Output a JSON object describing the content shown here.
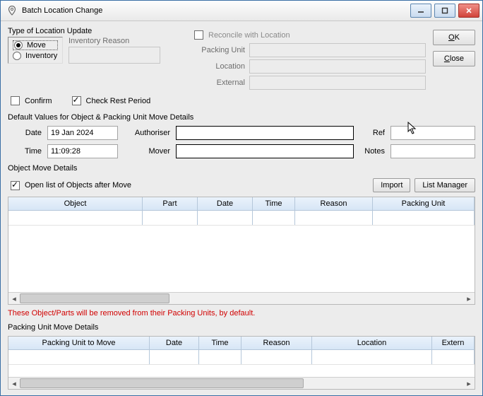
{
  "window": {
    "title": "Batch Location Change"
  },
  "buttons": {
    "ok": "OK",
    "close": "Close",
    "import": "Import",
    "list_manager": "List Manager"
  },
  "type_block": {
    "title": "Type of Location Update",
    "move": "Move",
    "inventory": "Inventory",
    "inv_reason_label": "Inventory Reason"
  },
  "reconcile": {
    "title": "Reconcile with Location",
    "packing_unit": "Packing Unit",
    "location": "Location",
    "external": "External"
  },
  "checks": {
    "confirm": "Confirm",
    "check_rest": "Check Rest Period"
  },
  "defaults": {
    "title": "Default Values for Object & Packing Unit Move Details",
    "date_label": "Date",
    "date_value": "19 Jan 2024",
    "time_label": "Time",
    "time_value": "11:09:28",
    "authoriser_label": "Authoriser",
    "authoriser_value": "",
    "mover_label": "Mover",
    "mover_value": "",
    "ref_label": "Ref",
    "ref_value": "",
    "notes_label": "Notes",
    "notes_value": ""
  },
  "object_section": {
    "title": "Object Move Details",
    "open_after": "Open list of Objects after Move",
    "columns": [
      "Object",
      "Part",
      "Date",
      "Time",
      "Reason",
      "Packing Unit"
    ]
  },
  "warning_text": "These Object/Parts will be removed from their Packing Units, by default.",
  "packing_section": {
    "title": "Packing Unit Move Details",
    "columns": [
      "Packing Unit to Move",
      "Date",
      "Time",
      "Reason",
      "Location",
      "Extern"
    ]
  }
}
